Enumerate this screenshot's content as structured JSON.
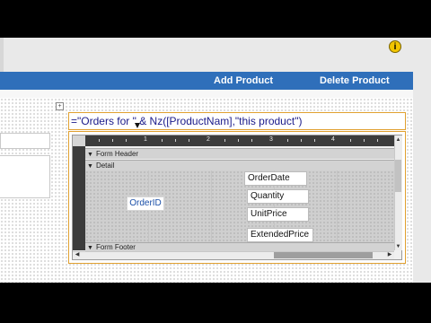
{
  "ribbon": {
    "add_product": "Add Product",
    "delete_product": "Delete Product"
  },
  "info_icon": {
    "glyph": "i",
    "color": "#f2c500"
  },
  "expression_box": {
    "value": "=\"Orders for \" & Nz([ProductNam],\"this product\")"
  },
  "subform": {
    "ruler_labels": [
      "1",
      "2",
      "3",
      "4"
    ],
    "sections": {
      "form_header": "Form Header",
      "detail": "Detail",
      "form_footer": "Form Footer"
    },
    "controls": {
      "order_id_label": "OrderID",
      "order_date": "OrderDate",
      "quantity": "Quantity",
      "unit_price": "UnitPrice",
      "extended_price": "ExtendedPrice"
    }
  },
  "colors": {
    "ribbon_blue": "#2f6fba",
    "selection_orange": "#e0a030",
    "label_blue": "#1a4fa8"
  }
}
